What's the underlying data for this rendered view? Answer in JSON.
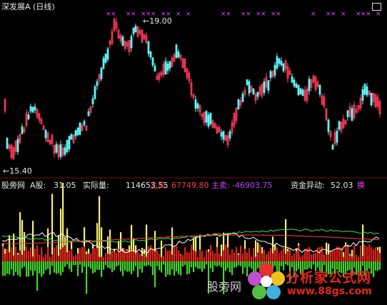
{
  "title": "深发展A (日线)",
  "price_high_label": "19.00",
  "price_low_label": "15.40",
  "indicator": {
    "name": "股旁网",
    "a_label": "A股:",
    "a_value": "31.05",
    "actual_label": "实际量:",
    "actual_value": "114653.55",
    "buy_label": "主买:",
    "buy_value": "67749.80",
    "sell_label": "主卖:",
    "sell_value": "-46903.75",
    "fund_label": "资金异动:",
    "fund_value": "52.03",
    "switch_label": "换"
  },
  "watermark": {
    "main": "分析家公式网",
    "url": "www.88gs.com",
    "left_text": "股旁网"
  },
  "colors": {
    "up": "#ff3b5c",
    "down": "#5ff7f7",
    "vol_yellow": "#f5ee7a",
    "vol_red": "#e0201a",
    "vol_green": "#44d42c",
    "marker": "#e040ff"
  }
}
